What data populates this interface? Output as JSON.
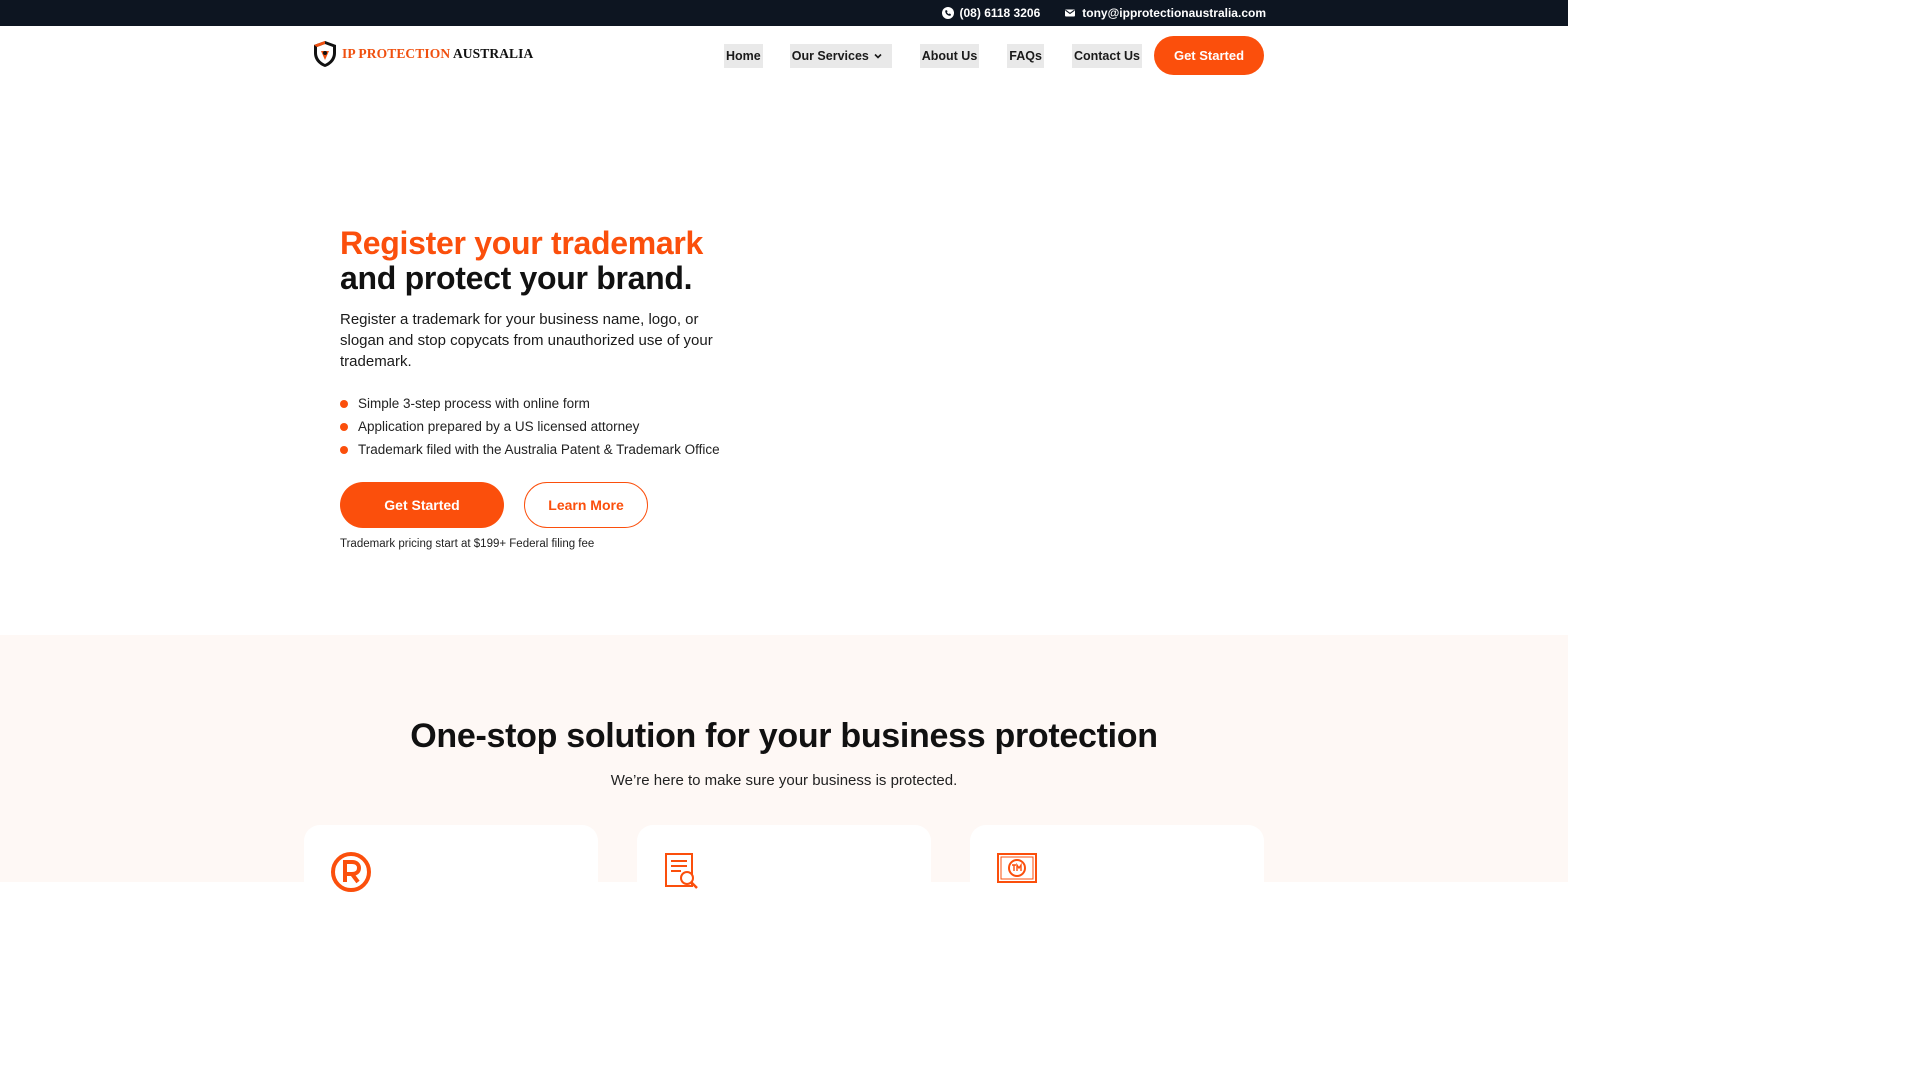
{
  "topbar": {
    "phone": "(08) 6118 3206",
    "email": "tony@ipprotectionaustralia.com",
    "phone_icon": "phone-icon",
    "email_icon": "mail-icon"
  },
  "brand": {
    "name_accent": "IP PROTECTION",
    "name_rest": "AUSTRALIA",
    "logo_icon": "shield-logo-icon"
  },
  "nav": {
    "items": [
      {
        "label": "Home"
      },
      {
        "label": "Our Services",
        "has_dropdown": true
      },
      {
        "label": "About Us"
      },
      {
        "label": "FAQs"
      },
      {
        "label": "Contact Us"
      }
    ],
    "cta": "Get Started"
  },
  "hero": {
    "title_accent": "Register your trademark",
    "title_rest": "and protect your brand.",
    "lead": "Register a trademark for your business name, logo, or slogan and stop copycats from unauthorized use of your trademark.",
    "bullets": [
      "Simple 3-step process with online form",
      "Application prepared by a US licensed attorney",
      "Trademark filed with the Australia Patent & Trademark Office"
    ],
    "primary_button": "Get Started",
    "secondary_button": "Learn More",
    "pricing_note": "Trademark pricing start at $199+ Federal filing fee"
  },
  "solutions": {
    "title": "One-stop solution for your business protection",
    "subtitle": "We’re here to make sure your business is protected.",
    "cards": [
      {
        "icon": "registered-mark-icon"
      },
      {
        "icon": "document-search-icon"
      },
      {
        "icon": "trademark-certificate-icon"
      }
    ]
  },
  "colors": {
    "accent": "#fb4f0c",
    "topbar": "#0d1521",
    "section_bg": "#fef8f5"
  }
}
